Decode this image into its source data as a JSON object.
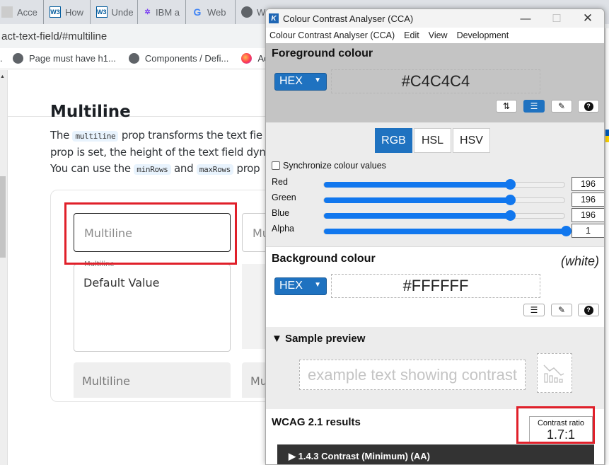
{
  "browser": {
    "tabs": [
      {
        "icon": "accessibility-favicon-icon",
        "label": "Acce"
      },
      {
        "icon": "w3c-icon",
        "label": "How"
      },
      {
        "icon": "w3c-icon",
        "label": "Unde"
      },
      {
        "icon": "ibm-bee-icon",
        "label": "IBM a"
      },
      {
        "icon": "google-icon",
        "label": "Web"
      },
      {
        "icon": "globe-icon",
        "label": "WC"
      }
    ],
    "address": "act-text-field/#multiline",
    "bookmarks": [
      {
        "icon": "globe-icon",
        "label": "Page must have h1..."
      },
      {
        "icon": "globe-icon",
        "label": "Components / Defi..."
      },
      {
        "icon": "firefox-icon",
        "label": "Access"
      }
    ]
  },
  "page": {
    "heading": "Multiline",
    "paragraph": {
      "line1_pre": "The ",
      "line1_code": "multiline",
      "line1_post": " prop transforms the text fie",
      "line2": "prop is set, the height of the text field dyna",
      "line3_pre": "You can use the ",
      "line3_code1": "minRows",
      "line3_mid": " and ",
      "line3_code2": "maxRows",
      "line3_post": " prop"
    },
    "fields": {
      "outlined_placeholder": "Multiline",
      "outlined_second_partial": "Mu",
      "default_label": "Multiline",
      "default_value": "Default Value",
      "filled_placeholder": "Multiline",
      "filled_second_partial": "Mu"
    }
  },
  "cca": {
    "title": "Colour Contrast Analyser (CCA)",
    "window_controls": {
      "minimize": "—",
      "maximize": "☐",
      "close": "✕"
    },
    "menu": [
      "Colour Contrast Analyser (CCA)",
      "Edit",
      "View",
      "Development"
    ],
    "foreground": {
      "title": "Foreground colour",
      "format": "HEX",
      "value": "#C4C4C4",
      "tools": [
        "swap-icon",
        "sliders-icon",
        "eyedropper-icon",
        "help-icon"
      ]
    },
    "mode_tabs": [
      {
        "label": "RGB",
        "active": true
      },
      {
        "label": "HSL",
        "active": false
      },
      {
        "label": "HSV",
        "active": false
      }
    ],
    "sync_label": "Synchronize colour values",
    "sync_checked": false,
    "channels": [
      {
        "label": "Red",
        "value": "196",
        "fraction": 0.7686
      },
      {
        "label": "Green",
        "value": "196",
        "fraction": 0.7686
      },
      {
        "label": "Blue",
        "value": "196",
        "fraction": 0.7686
      },
      {
        "label": "Alpha",
        "value": "1",
        "fraction": 1.0
      }
    ],
    "background": {
      "title": "Background colour",
      "name": "(white)",
      "format": "HEX",
      "value": "#FFFFFF"
    },
    "preview": {
      "title": "▼ Sample preview",
      "sample_text": "example text showing contrast"
    },
    "results": {
      "title": "WCAG 2.1 results",
      "ratio_label": "Contrast ratio",
      "ratio_value": "1.7:1",
      "criterion": "▶ 1.4.3 Contrast (Minimum) (AA)"
    },
    "colors": {
      "accent": "#1f72c0",
      "slider": "#1177ee",
      "foreground": "#C4C4C4",
      "highlight": "#e0202a"
    }
  }
}
